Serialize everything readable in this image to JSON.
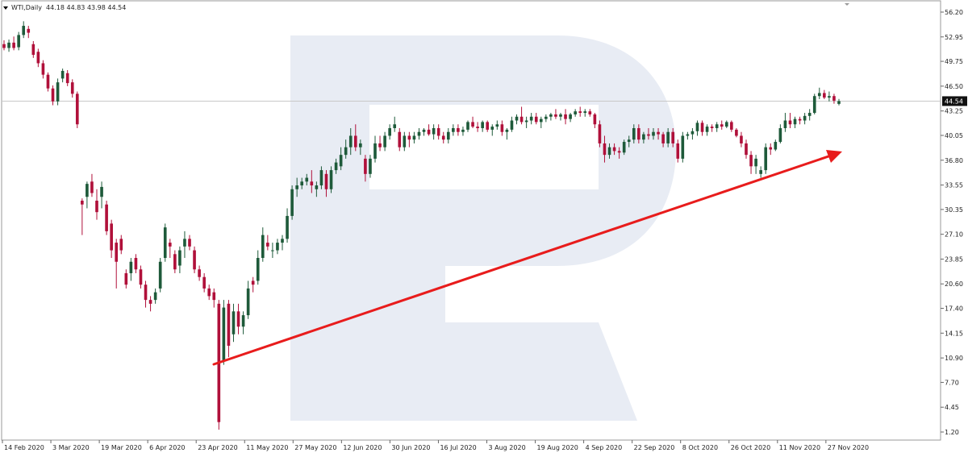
{
  "header": {
    "symbol": "WTI,Daily",
    "ohlc": "44.18 44.83 43.98 44.54"
  },
  "price_label": "44.54",
  "colors": {
    "up": "#1e5a3a",
    "down": "#b0103a",
    "wick": "#333333",
    "trendline": "#e81c1c",
    "grid_line": "#c8c8c8",
    "watermark": "#e8ecf4",
    "price_tag_bg": "#111111",
    "price_tag_fg": "#ffffff"
  },
  "chart_data": {
    "type": "candlestick",
    "y_axis_ticks": [
      "56.20",
      "52.95",
      "49.75",
      "46.50",
      "43.25",
      "40.05",
      "36.80",
      "33.55",
      "30.35",
      "27.10",
      "23.85",
      "20.60",
      "17.40",
      "14.15",
      "10.90",
      "7.70",
      "4.45",
      "1.20"
    ],
    "x_axis_ticks": [
      "14 Feb 2020",
      "3 Mar 2020",
      "19 Mar 2020",
      "6 Apr 2020",
      "23 Apr 2020",
      "11 May 2020",
      "27 May 2020",
      "12 Jun 2020",
      "30 Jun 2020",
      "16 Jul 2020",
      "3 Aug 2020",
      "19 Aug 2020",
      "4 Sep 2020",
      "22 Sep 2020",
      "8 Oct 2020",
      "26 Oct 2020",
      "11 Nov 2020",
      "27 Nov 2020"
    ],
    "last_price": 44.54,
    "ylim": [
      0,
      57.5
    ],
    "candles": [
      [
        52.0,
        52.5,
        51.2,
        51.5
      ],
      [
        51.5,
        52.6,
        51.0,
        52.2
      ],
      [
        52.2,
        53.0,
        51.2,
        51.5
      ],
      [
        51.6,
        53.6,
        51.2,
        53.2
      ],
      [
        53.2,
        55.0,
        52.8,
        54.4
      ],
      [
        54.0,
        54.4,
        52.8,
        53.5
      ],
      [
        52.0,
        52.4,
        50.2,
        50.6
      ],
      [
        51.0,
        51.4,
        49.0,
        49.5
      ],
      [
        49.5,
        49.9,
        47.5,
        48.0
      ],
      [
        48.0,
        48.3,
        45.8,
        46.2
      ],
      [
        46.2,
        46.6,
        44.0,
        44.5
      ],
      [
        44.5,
        47.5,
        44.0,
        47.0
      ],
      [
        47.5,
        48.8,
        47.0,
        48.5
      ],
      [
        48.2,
        48.6,
        46.5,
        46.9
      ],
      [
        47.0,
        47.4,
        45.0,
        45.5
      ],
      [
        45.5,
        45.8,
        41.0,
        41.5
      ],
      [
        31.5,
        31.8,
        27.0,
        31.0
      ],
      [
        32.0,
        34.0,
        30.5,
        33.7
      ],
      [
        34.0,
        35.0,
        32.0,
        32.5
      ],
      [
        31.5,
        33.0,
        29.0,
        30.0
      ],
      [
        32.0,
        34.0,
        30.5,
        33.3
      ],
      [
        31.0,
        31.5,
        27.0,
        27.5
      ],
      [
        28.5,
        29.0,
        24.0,
        25.0
      ],
      [
        26.0,
        26.5,
        20.0,
        23.5
      ],
      [
        26.5,
        27.0,
        24.5,
        25.0
      ],
      [
        22.0,
        22.5,
        20.0,
        20.5
      ],
      [
        22.0,
        24.0,
        21.0,
        23.5
      ],
      [
        24.0,
        24.5,
        22.0,
        22.5
      ],
      [
        22.5,
        23.0,
        20.0,
        20.5
      ],
      [
        20.5,
        21.0,
        17.5,
        18.5
      ],
      [
        18.5,
        19.0,
        17.0,
        18.0
      ],
      [
        18.5,
        20.0,
        18.0,
        19.5
      ],
      [
        20.0,
        24.0,
        19.5,
        23.5
      ],
      [
        24.0,
        28.5,
        23.5,
        28.0
      ],
      [
        26.0,
        26.5,
        24.0,
        25.5
      ],
      [
        24.5,
        25.0,
        22.0,
        22.5
      ],
      [
        23.0,
        25.5,
        22.0,
        25.0
      ],
      [
        25.5,
        27.5,
        24.0,
        26.5
      ],
      [
        26.5,
        27.0,
        25.0,
        25.5
      ],
      [
        25.0,
        25.5,
        22.0,
        22.5
      ],
      [
        22.5,
        23.0,
        21.0,
        21.5
      ],
      [
        21.5,
        22.0,
        19.5,
        20.0
      ],
      [
        20.0,
        20.5,
        18.5,
        19.0
      ],
      [
        19.5,
        20.0,
        17.5,
        18.5
      ],
      [
        18.0,
        18.5,
        1.5,
        2.5
      ],
      [
        10.5,
        18.5,
        10.0,
        17.5
      ],
      [
        18.0,
        18.5,
        11.0,
        12.5
      ],
      [
        14.0,
        18.0,
        13.0,
        17.0
      ],
      [
        17.0,
        18.0,
        14.0,
        15.0
      ],
      [
        15.0,
        17.0,
        14.0,
        16.5
      ],
      [
        16.5,
        21.0,
        16.0,
        20.0
      ],
      [
        21.0,
        21.5,
        19.5,
        20.5
      ],
      [
        21.0,
        25.0,
        20.5,
        24.0
      ],
      [
        24.0,
        28.0,
        23.5,
        27.0
      ],
      [
        26.0,
        27.0,
        25.0,
        25.5
      ],
      [
        25.0,
        26.0,
        24.0,
        25.0
      ],
      [
        25.0,
        26.5,
        24.5,
        26.0
      ],
      [
        26.0,
        27.0,
        25.0,
        26.5
      ],
      [
        26.5,
        30.5,
        26.0,
        29.5
      ],
      [
        29.5,
        33.5,
        29.0,
        33.0
      ],
      [
        33.0,
        34.5,
        32.0,
        33.5
      ],
      [
        33.5,
        34.5,
        33.0,
        34.0
      ],
      [
        34.0,
        35.0,
        33.5,
        34.5
      ],
      [
        34.0,
        35.5,
        32.5,
        33.5
      ],
      [
        33.0,
        34.0,
        32.0,
        33.5
      ],
      [
        33.5,
        36.0,
        33.0,
        35.5
      ],
      [
        35.0,
        35.5,
        32.0,
        33.0
      ],
      [
        33.0,
        36.0,
        32.5,
        35.5
      ],
      [
        35.5,
        37.0,
        35.0,
        36.5
      ],
      [
        36.0,
        38.5,
        35.5,
        37.5
      ],
      [
        37.5,
        39.5,
        37.0,
        38.5
      ],
      [
        38.5,
        41.0,
        37.5,
        40.0
      ],
      [
        40.0,
        41.5,
        38.0,
        38.5
      ],
      [
        38.5,
        39.5,
        37.5,
        39.0
      ],
      [
        37.0,
        37.5,
        34.0,
        35.0
      ],
      [
        35.0,
        37.5,
        34.5,
        37.0
      ],
      [
        37.0,
        40.0,
        36.5,
        39.0
      ],
      [
        39.0,
        40.0,
        38.0,
        38.5
      ],
      [
        38.5,
        40.5,
        38.0,
        40.0
      ],
      [
        40.0,
        41.5,
        39.5,
        41.0
      ],
      [
        41.0,
        42.5,
        40.5,
        41.5
      ],
      [
        40.5,
        41.0,
        38.0,
        38.5
      ],
      [
        38.5,
        40.5,
        38.0,
        40.0
      ],
      [
        40.0,
        40.5,
        38.5,
        39.5
      ],
      [
        39.5,
        40.5,
        39.0,
        40.0
      ],
      [
        40.0,
        41.0,
        39.5,
        40.5
      ],
      [
        40.5,
        41.0,
        40.0,
        40.8
      ],
      [
        40.8,
        41.5,
        40.0,
        40.2
      ],
      [
        40.2,
        41.5,
        39.5,
        41.0
      ],
      [
        41.0,
        41.5,
        39.5,
        40.0
      ],
      [
        40.0,
        40.5,
        39.0,
        39.5
      ],
      [
        39.5,
        41.0,
        39.0,
        40.5
      ],
      [
        40.5,
        41.5,
        40.0,
        41.0
      ],
      [
        41.0,
        41.5,
        40.0,
        40.5
      ],
      [
        40.5,
        41.2,
        40.0,
        40.8
      ],
      [
        40.8,
        42.0,
        40.5,
        41.8
      ],
      [
        41.8,
        42.5,
        41.0,
        41.2
      ],
      [
        41.2,
        41.8,
        40.5,
        41.0
      ],
      [
        41.0,
        42.0,
        40.5,
        41.8
      ],
      [
        41.8,
        42.0,
        40.5,
        40.8
      ],
      [
        40.8,
        41.5,
        40.0,
        41.2
      ],
      [
        41.2,
        42.0,
        40.8,
        41.5
      ],
      [
        41.5,
        42.0,
        40.0,
        40.5
      ],
      [
        40.5,
        41.0,
        39.5,
        40.8
      ],
      [
        40.8,
        42.5,
        40.5,
        42.0
      ],
      [
        42.0,
        42.8,
        41.5,
        42.5
      ],
      [
        42.5,
        43.8,
        41.5,
        41.8
      ],
      [
        41.8,
        42.5,
        41.0,
        42.0
      ],
      [
        42.0,
        43.0,
        41.5,
        42.5
      ],
      [
        42.5,
        43.0,
        41.5,
        41.8
      ],
      [
        41.8,
        42.5,
        41.0,
        42.2
      ],
      [
        42.2,
        42.8,
        41.8,
        42.5
      ],
      [
        42.5,
        43.0,
        42.0,
        42.8
      ],
      [
        42.8,
        43.5,
        42.2,
        42.5
      ],
      [
        42.5,
        43.0,
        42.0,
        42.8
      ],
      [
        42.8,
        43.5,
        41.5,
        42.2
      ],
      [
        42.2,
        43.0,
        41.8,
        42.8
      ],
      [
        42.8,
        43.5,
        42.5,
        43.2
      ],
      [
        43.2,
        43.8,
        42.5,
        43.0
      ],
      [
        43.0,
        43.5,
        42.5,
        43.2
      ],
      [
        43.2,
        43.5,
        42.5,
        42.8
      ],
      [
        42.8,
        43.0,
        41.0,
        41.5
      ],
      [
        41.5,
        42.0,
        38.5,
        39.0
      ],
      [
        39.0,
        40.0,
        36.5,
        37.5
      ],
      [
        37.5,
        39.0,
        37.0,
        38.5
      ],
      [
        38.5,
        39.0,
        37.5,
        38.0
      ],
      [
        38.0,
        38.5,
        37.0,
        37.8
      ],
      [
        37.8,
        39.5,
        37.5,
        39.2
      ],
      [
        39.2,
        40.0,
        38.5,
        39.5
      ],
      [
        39.5,
        41.5,
        39.0,
        41.0
      ],
      [
        41.0,
        41.5,
        39.0,
        39.5
      ],
      [
        39.5,
        40.5,
        39.0,
        40.2
      ],
      [
        40.2,
        41.0,
        39.5,
        40.0
      ],
      [
        40.0,
        41.0,
        39.5,
        40.5
      ],
      [
        40.5,
        41.0,
        39.5,
        40.2
      ],
      [
        40.2,
        40.5,
        38.5,
        39.0
      ],
      [
        39.0,
        41.0,
        38.5,
        40.5
      ],
      [
        40.5,
        41.0,
        38.5,
        39.0
      ],
      [
        39.0,
        39.5,
        36.5,
        37.0
      ],
      [
        37.0,
        40.5,
        36.5,
        40.0
      ],
      [
        40.0,
        40.5,
        39.5,
        40.2
      ],
      [
        40.2,
        41.0,
        39.5,
        40.6
      ],
      [
        40.6,
        42.0,
        40.0,
        41.7
      ],
      [
        41.7,
        42.0,
        40.0,
        40.5
      ],
      [
        40.5,
        41.5,
        40.0,
        41.2
      ],
      [
        41.2,
        41.5,
        40.5,
        41.0
      ],
      [
        41.0,
        41.8,
        40.5,
        41.5
      ],
      [
        41.5,
        42.0,
        40.8,
        41.2
      ],
      [
        41.2,
        42.0,
        41.0,
        41.8
      ],
      [
        41.8,
        42.0,
        40.5,
        40.8
      ],
      [
        40.8,
        41.0,
        39.8,
        40.0
      ],
      [
        40.0,
        40.5,
        38.5,
        39.0
      ],
      [
        39.0,
        39.5,
        37.0,
        37.5
      ],
      [
        37.5,
        38.0,
        35.0,
        36.0
      ],
      [
        36.0,
        37.5,
        35.0,
        37.0
      ],
      [
        35.0,
        36.0,
        34.5,
        35.5
      ],
      [
        35.5,
        39.0,
        35.0,
        38.5
      ],
      [
        38.5,
        39.0,
        37.5,
        38.2
      ],
      [
        38.2,
        39.5,
        38.0,
        39.2
      ],
      [
        39.2,
        41.5,
        39.0,
        41.0
      ],
      [
        41.0,
        43.0,
        40.5,
        42.0
      ],
      [
        42.0,
        43.0,
        41.0,
        41.5
      ],
      [
        41.5,
        42.5,
        41.0,
        42.2
      ],
      [
        42.2,
        42.5,
        41.5,
        42.0
      ],
      [
        42.0,
        43.0,
        41.5,
        42.6
      ],
      [
        42.6,
        43.5,
        42.0,
        43.0
      ],
      [
        43.0,
        45.5,
        42.8,
        45.2
      ],
      [
        45.2,
        46.3,
        44.8,
        45.6
      ],
      [
        45.6,
        46.0,
        44.8,
        45.0
      ],
      [
        45.0,
        45.8,
        44.5,
        45.2
      ],
      [
        45.2,
        45.5,
        44.2,
        44.6
      ],
      [
        44.18,
        44.83,
        43.98,
        44.54
      ]
    ]
  }
}
